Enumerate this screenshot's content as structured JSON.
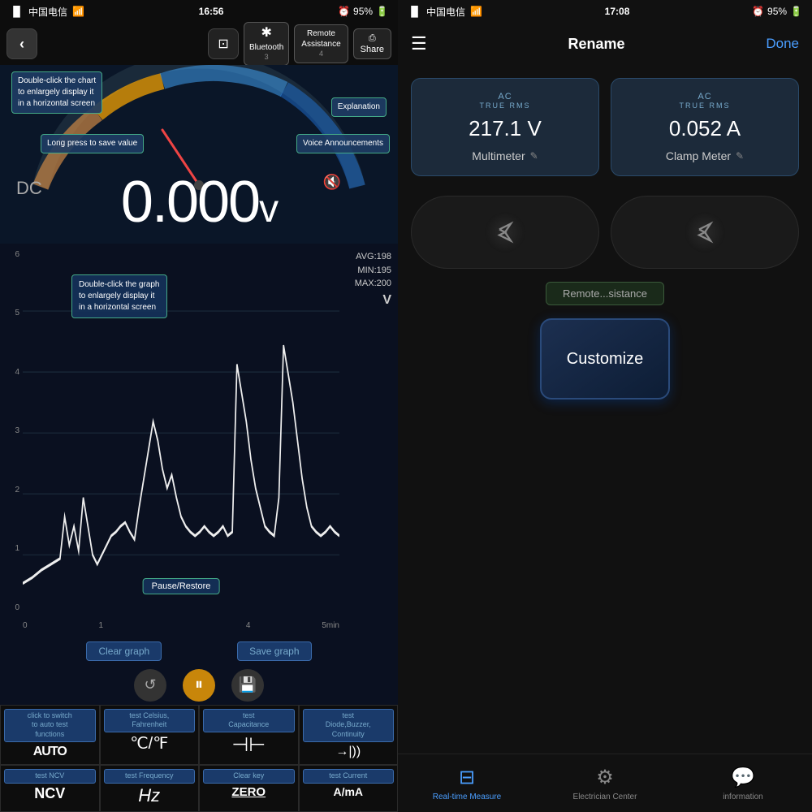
{
  "left": {
    "status": {
      "carrier": "中国电信",
      "time": "16:56",
      "battery": "95%"
    },
    "toolbar": {
      "back_label": "‹",
      "btn2_label": "⊡",
      "bluetooth_label": "Bluetooth\n3",
      "remote_label": "Remote\nAssistance\n4",
      "share_label": "Share"
    },
    "tooltip_chart": "Double-click the chart\nto enlargely display it\nin a horizontal screen",
    "tooltip_explanation": "Explanation",
    "tooltip_save": "Long press to save value",
    "tooltip_voice": "Voice Announcements",
    "dc_label": "DC",
    "reading": "0.000",
    "unit": "v",
    "graph": {
      "avg": "AVG:198",
      "min": "MIN:195",
      "max": "MAX:200",
      "unit": "V",
      "y_labels": [
        "6",
        "5",
        "4",
        "3",
        "2",
        "1",
        "0"
      ],
      "x_labels": [
        "0",
        "1",
        "",
        "",
        "",
        "",
        "4",
        "",
        "5min"
      ],
      "tip": "Double-click the graph\nto enlargely display it\nin a horizontal screen",
      "pause_label": "Pause/Restore"
    },
    "controls": {
      "clear_graph": "Clear graph",
      "save_graph": "Save graph"
    },
    "func_cells": [
      {
        "tip": "click to switch\nto auto test\nfunctions",
        "icon": "AUTO",
        "label": ""
      },
      {
        "tip": "test Celsius,\nFahrenheit",
        "icon": "℃/℉",
        "label": ""
      },
      {
        "tip": "test\nCapacitance",
        "icon": "⊣⊢",
        "label": ""
      },
      {
        "tip": "test\nDiode,Buzzer,\nContinuity",
        "icon": "→|))",
        "label": ""
      },
      {
        "tip": "test NCV",
        "icon": "NCV",
        "label": ""
      },
      {
        "tip": "test Frequency",
        "icon": "Hz",
        "label": ""
      },
      {
        "tip": "Clear key",
        "icon": "ZERO",
        "label": ""
      },
      {
        "tip": "test Current",
        "icon": "A/mA",
        "label": ""
      }
    ]
  },
  "right": {
    "status": {
      "carrier": "中国电信",
      "time": "17:08",
      "battery": "95%"
    },
    "header": {
      "menu_icon": "☰",
      "title": "Rename",
      "done": "Done"
    },
    "multimeter": {
      "mode": "AC",
      "trms": "TRUE RMS",
      "value": "217.1 V",
      "device_name": "Multimeter",
      "edit_icon": "✎"
    },
    "clamp": {
      "mode": "AC",
      "trms": "TRUE RMS",
      "value": "0.052 A",
      "device_name": "Clamp Meter",
      "edit_icon": "✎"
    },
    "bluetooth1_icon": "⚡",
    "bluetooth2_icon": "⚡",
    "remote_label": "Remote...sistance",
    "customize_label": "Customize",
    "tabs": [
      {
        "icon": "⊟",
        "label": "Real-time Measure",
        "active": true
      },
      {
        "icon": "⚙",
        "label": "Electrician Center",
        "active": false
      },
      {
        "icon": "💬",
        "label": "information",
        "active": false
      }
    ]
  }
}
